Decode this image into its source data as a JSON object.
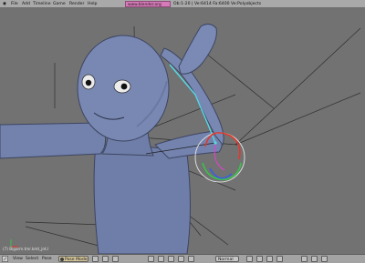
{
  "menubar": {
    "items": [
      "File",
      "Add",
      "Timeline",
      "Game",
      "Render",
      "Help"
    ],
    "file_tab": "www.blender.org 243",
    "stats": "Ob:1-20 | Ve:6414 Fa:6400 Ve:Polyobjects"
  },
  "viewport": {
    "label": "(7) Bigarm.tmr.kmt_jnt.l"
  },
  "header": {
    "view": "View",
    "select": "Select",
    "pose": "Pose",
    "mode": "Pose Mode",
    "orientation": "Normal"
  },
  "colors": {
    "background": "#727272",
    "character": "#7585b0",
    "bone_selected": "#56d9e6",
    "manipulator_red": "#e03a2d",
    "manipulator_green": "#38c24c",
    "manipulator_blue": "#3a5ee0"
  }
}
